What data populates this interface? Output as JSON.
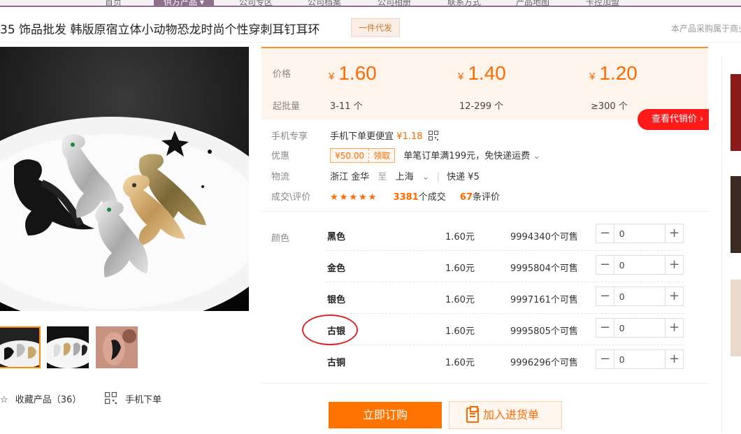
{
  "topnav": {
    "items": [
      "首页",
      "供方产品 ▾",
      "公司专区",
      "公司档案",
      "公司相册",
      "联系方式",
      "产品地图",
      "卡控加盟"
    ]
  },
  "product": {
    "title": "35 饰品批发 韩版原宿立体小动物恐龙时尚个性穿刺耳钉耳环",
    "tag": "一件代发",
    "notice": "本产品采购属于商业"
  },
  "price_table": {
    "price_label": "价格",
    "moq_label": "起批量",
    "currency": "¥",
    "tiers": [
      {
        "price": "1.60",
        "range": "3-11 个"
      },
      {
        "price": "1.40",
        "range": "12-299 个"
      },
      {
        "price": "1.20",
        "range": "≥300 个"
      }
    ],
    "agent_button": "查看代销价 ›"
  },
  "info": {
    "mobile": {
      "label": "手机专享",
      "text": "手机下单更便宜",
      "price": "¥1.18"
    },
    "promo": {
      "label": "优惠",
      "coupon_value": "¥50.00",
      "coupon_get": "领取",
      "text": "单笔订单满199元，免快递运费"
    },
    "shipping": {
      "label": "物流",
      "from": "浙江 金华",
      "to_word": "至",
      "to": "上海",
      "method": "快递 ¥5"
    },
    "reviews": {
      "label": "成交\\评价",
      "stars": "★★★★★",
      "deals_count": "3381",
      "deals_suffix": "个成交",
      "reviews_count": "67",
      "reviews_suffix": "条评价"
    }
  },
  "variants": {
    "label": "颜色",
    "items": [
      {
        "name": "黑色",
        "price": "1.60元",
        "stock": "9994340个可售",
        "qty": "0"
      },
      {
        "name": "金色",
        "price": "1.60元",
        "stock": "9995804个可售",
        "qty": "0"
      },
      {
        "name": "银色",
        "price": "1.60元",
        "stock": "9997161个可售",
        "qty": "0"
      },
      {
        "name": "古银",
        "price": "1.60元",
        "stock": "9995805个可售",
        "qty": "0"
      },
      {
        "name": "古铜",
        "price": "1.60元",
        "stock": "9996296个可售",
        "qty": "0"
      }
    ]
  },
  "actions": {
    "buy_now": "立即订购",
    "add_to_cart": "加入进货单",
    "favorite": "收藏产品（36）",
    "mobile_order": "手机下单"
  },
  "colors": {
    "accent": "#ff6a00",
    "red": "#ff1a1a",
    "nav": "#8e6f8c"
  }
}
